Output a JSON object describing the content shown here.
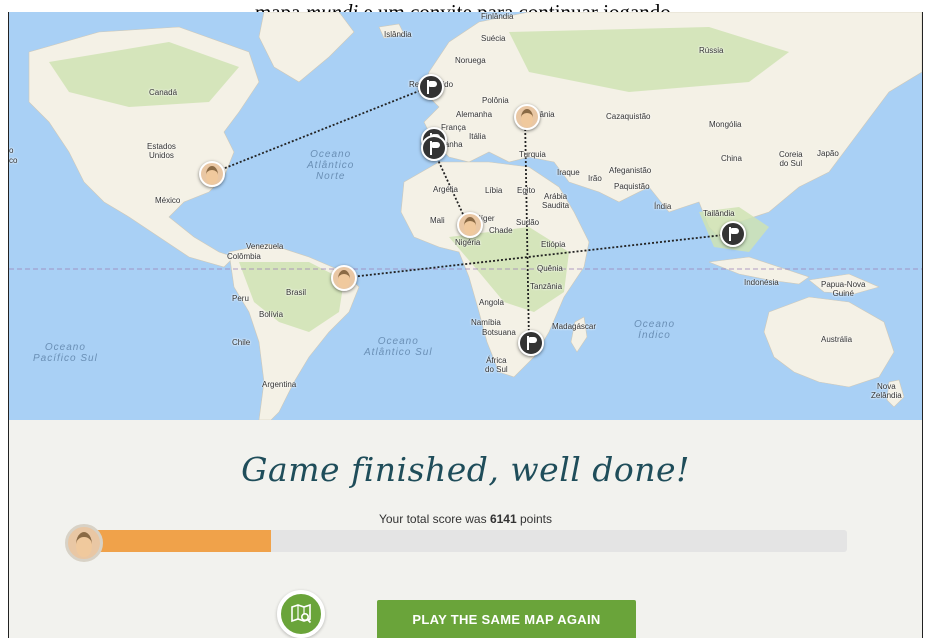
{
  "caption": {
    "before": "mapa ",
    "italic": "mundi",
    "after": " e um convite para continuar jogando."
  },
  "map": {
    "labels": {
      "finlandia": "Finlândia",
      "islandia": "Islândia",
      "suecia": "Suécia",
      "noruega": "Noruega",
      "russia": "Rússia",
      "canada": "Canadá",
      "reino_unido": "Reino Unido",
      "polonia": "Polônia",
      "alemanha": "Alemanha",
      "ucrania": "Ucrânia",
      "franca": "França",
      "italia": "Itália",
      "espanha": "Espanha",
      "cazaquistao": "Cazaquistão",
      "mongolia": "Mongólia",
      "turquia": "Turquia",
      "estados_unidos": "Estados\nUnidos",
      "china": "China",
      "coreia_do_sul": "Coreia\ndo Sul",
      "japao": "Japão",
      "iraque": "Iraque",
      "ira": "Irão",
      "afeganistao": "Afeganistão",
      "paquistao": "Paquistão",
      "argelia": "Argélia",
      "libia": "Líbia",
      "egito": "Egito",
      "arabia_saudita": "Arábia\nSaudita",
      "india": "Índia",
      "mexico": "México",
      "tailandia": "Tailândia",
      "mali": "Mali",
      "niger": "Níger",
      "chade": "Chade",
      "sudao": "Sudão",
      "nigeria": "Nigéria",
      "etiopia": "Etiópia",
      "venezuela": "Venezuela",
      "colombia": "Colômbia",
      "quenia": "Quênia",
      "tanzania": "Tanzânia",
      "indonesia": "Indonésia",
      "papua": "Papua-Nova\nGuiné",
      "brasil": "Brasil",
      "angola": "Angola",
      "peru": "Peru",
      "bolivia": "Bolívia",
      "namibia": "Namíbia",
      "madagascar": "Madagáscar",
      "botsuana": "Botsuana",
      "chile": "Chile",
      "australia": "Austrália",
      "africa_do_sul": "África\ndo Sul",
      "argentina": "Argentina",
      "nova_zelandia": "Nova\nZelândia",
      "mexico_edge": "o",
      "edge_co": "co"
    },
    "oceans": {
      "atlantico_norte": "Oceano\nAtlântico\nNorte",
      "atlantico_sul": "Oceano\nAtlântico Sul",
      "pacifico_sul": "Oceano\nPacífico Sul",
      "indico": "Oceano\nÍndico"
    },
    "colors": {
      "water": "#a9d0f5",
      "land": "#f4f1e6",
      "green": "#cfe3b3",
      "route": "#222222",
      "equator": "#9a7fb5"
    }
  },
  "result": {
    "title": "Game finished, well done!",
    "score_prefix": "Your total score was ",
    "score_value": "6141",
    "score_suffix": " points",
    "progress_fraction": 0.25,
    "play_again_label": "PLAY THE SAME MAP AGAIN",
    "map_button_icon": "map-search-icon",
    "colors": {
      "title": "#1f4d5a",
      "accent_green": "#6aa43a",
      "progress_orange": "#f0a24a"
    }
  }
}
